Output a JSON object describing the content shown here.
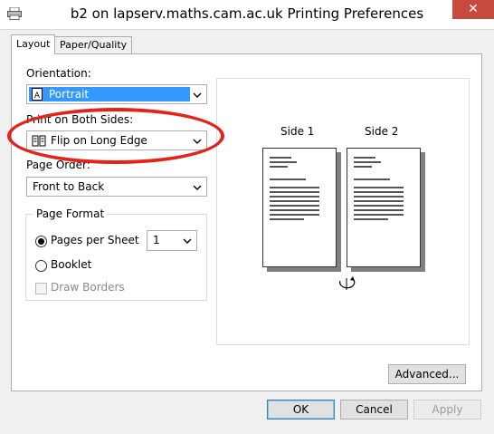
{
  "window": {
    "title": "b2 on lapserv.maths.cam.ac.uk Printing Preferences",
    "close_glyph": "✕"
  },
  "tabs": [
    {
      "label": "Layout",
      "active": true
    },
    {
      "label": "Paper/Quality",
      "active": false
    }
  ],
  "orientation": {
    "label": "Orientation:",
    "value": "Portrait",
    "icon": "portrait-page-icon"
  },
  "duplex": {
    "label": "Print on Both Sides:",
    "value": "Flip on Long Edge",
    "icon": "flip-book-icon"
  },
  "page_order": {
    "label": "Page Order:",
    "value": "Front to Back"
  },
  "page_format": {
    "title": "Page Format",
    "pages_per_sheet_label": "Pages per Sheet",
    "pages_per_sheet_value": "1",
    "pages_per_sheet_selected": true,
    "booklet_label": "Booklet",
    "booklet_selected": false,
    "draw_borders_label": "Draw Borders",
    "draw_borders_checked": false,
    "draw_borders_enabled": false
  },
  "preview": {
    "side1_label": "Side 1",
    "side2_label": "Side 2",
    "flip_icon": "flip-rotate-icon"
  },
  "buttons": {
    "advanced": "Advanced...",
    "ok": "OK",
    "cancel": "Cancel",
    "apply": "Apply"
  },
  "colors": {
    "selection": "#3399ff",
    "annotation": "#e2231a",
    "close": "#c74a3f"
  }
}
